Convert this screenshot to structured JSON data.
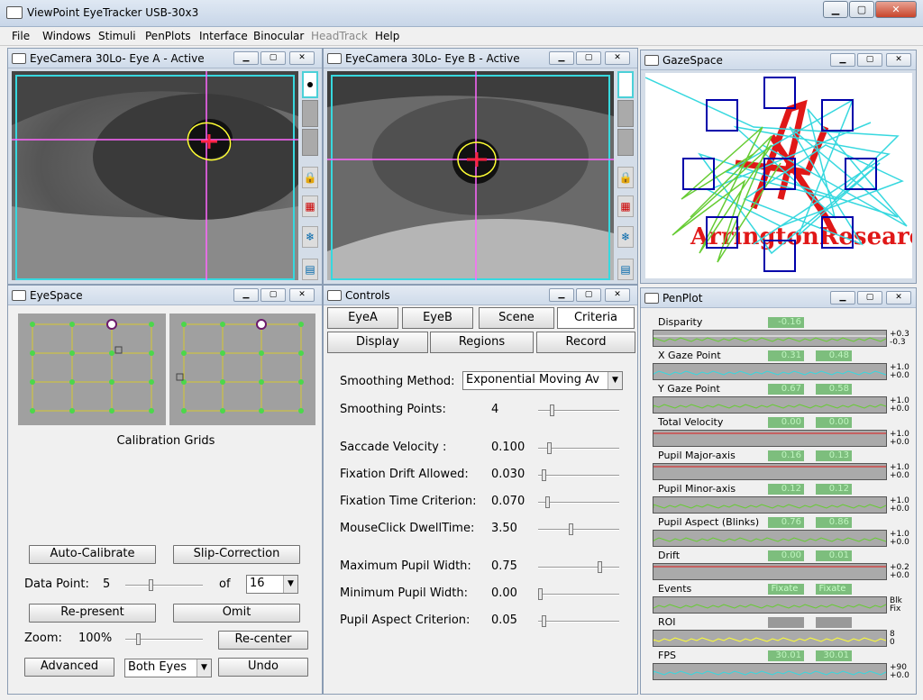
{
  "app": {
    "title": "ViewPoint EyeTracker USB-30x3"
  },
  "menu": [
    "File",
    "Windows",
    "Stimuli",
    "PenPlots",
    "Interface",
    "Binocular",
    "HeadTrack",
    "Help"
  ],
  "eye_a": {
    "title": "EyeCamera 30Lo- Eye A - Active"
  },
  "eye_b": {
    "title": "EyeCamera 30Lo- Eye B - Active"
  },
  "gaze": {
    "title": "GazeSpace",
    "watermark": "ArringtonResearch"
  },
  "eyespace": {
    "title": "EyeSpace",
    "grids_label": "Calibration Grids",
    "auto_calibrate": "Auto-Calibrate",
    "slip_correction": "Slip-Correction",
    "data_point_label": "Data Point:",
    "data_point_value": "5",
    "of_label": "of",
    "of_value": "16",
    "represent": "Re-present",
    "omit": "Omit",
    "zoom_label": "Zoom:",
    "zoom_value": "100%",
    "recenter": "Re-center",
    "advanced": "Advanced",
    "eyes_value": "Both Eyes",
    "undo": "Undo"
  },
  "controls": {
    "title": "Controls",
    "tabs_row1": [
      "EyeA",
      "EyeB",
      "Scene",
      "Criteria"
    ],
    "tabs_row2": [
      "Display",
      "Regions",
      "Record"
    ],
    "smoothing_method_label": "Smoothing Method:",
    "smoothing_method_value": "Exponential Moving Av",
    "rows": [
      {
        "label": "Smoothing Points:",
        "value": "4",
        "slider": 0.15
      },
      {
        "label": "Saccade Velocity :",
        "value": "0.100",
        "slider": 0.12
      },
      {
        "label": "Fixation Drift Allowed:",
        "value": "0.030",
        "slider": 0.05
      },
      {
        "label": "Fixation Time Criterion:",
        "value": "0.070",
        "slider": 0.1
      },
      {
        "label": "MouseClick DwellTime:",
        "value": "3.50",
        "slider": 0.4
      },
      {
        "label": "Maximum Pupil Width:",
        "value": "0.75",
        "slider": 0.78
      },
      {
        "label": "Minimum Pupil Width:",
        "value": "0.00",
        "slider": 0.0
      },
      {
        "label": "Pupil Aspect Criterion:",
        "value": "0.05",
        "slider": 0.05
      }
    ]
  },
  "penplot": {
    "title": "PenPlot",
    "rows": [
      {
        "label": "Disparity",
        "v1": "-0.16",
        "v2": "",
        "hi": "+0.3",
        "lo": "-0.3"
      },
      {
        "label": "X Gaze Point",
        "v1": "0.31",
        "v2": "0.48",
        "hi": "+1.0",
        "lo": "+0.0"
      },
      {
        "label": "Y Gaze Point",
        "v1": "0.67",
        "v2": "0.58",
        "hi": "+1.0",
        "lo": "+0.0"
      },
      {
        "label": "Total Velocity",
        "v1": "0.00",
        "v2": "0.00",
        "hi": "+1.0",
        "lo": "+0.0"
      },
      {
        "label": "Pupil Major-axis",
        "v1": "0.16",
        "v2": "0.13",
        "hi": "+1.0",
        "lo": "+0.0"
      },
      {
        "label": "Pupil Minor-axis",
        "v1": "0.12",
        "v2": "0.12",
        "hi": "+1.0",
        "lo": "+0.0"
      },
      {
        "label": "Pupil Aspect (Blinks)",
        "v1": "0.76",
        "v2": "0.86",
        "hi": "+1.0",
        "lo": "+0.0"
      },
      {
        "label": "Drift",
        "v1": "0.00",
        "v2": "0.01",
        "hi": "+0.2",
        "lo": "+0.0"
      },
      {
        "label": "Events",
        "v1": "Fixate",
        "v2": "Fixate",
        "hi": "Blk",
        "lo": "Fix"
      },
      {
        "label": "ROI",
        "v1": "",
        "v2": "",
        "hi": "8",
        "lo": "0"
      },
      {
        "label": "FPS",
        "v1": "30.01",
        "v2": "30.01",
        "hi": "+90",
        "lo": "+0.0"
      }
    ]
  },
  "colors": {
    "cyan": "#37d8df",
    "magenta": "#ff66ff",
    "yellow": "#ffff33",
    "red": "#e01818",
    "green": "#66cc33",
    "blue": "#0000aa"
  }
}
